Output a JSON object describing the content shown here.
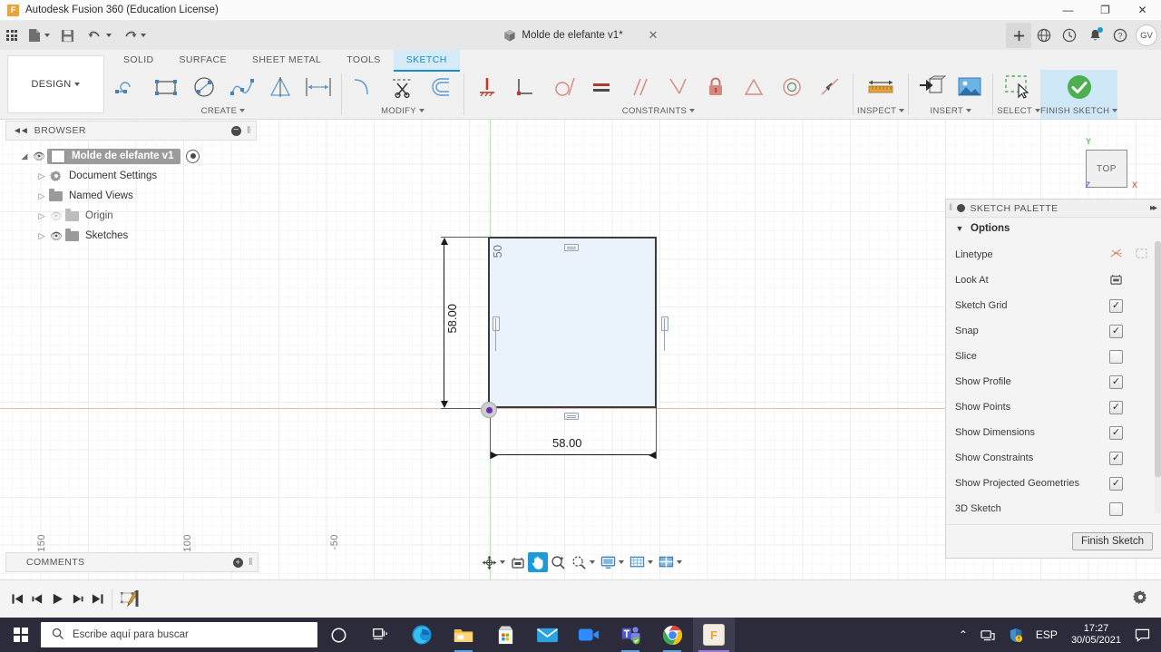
{
  "titlebar": {
    "app_title": "Autodesk Fusion 360 (Education License)",
    "logo_text": "F",
    "minimize": "—",
    "maximize": "❐",
    "close": "✕"
  },
  "quickaccess": {
    "grid_icon": "app-grid-icon",
    "new_icon": "new-document-icon",
    "save_icon": "save-icon",
    "undo_icon": "undo-icon",
    "redo_icon": "redo-icon",
    "document_tab": "Molde de elefante v1*",
    "document_close": "✕",
    "plus": "+",
    "data_panel_icon": "globe-icon",
    "history_icon": "clock-icon",
    "notification_icon": "bell-icon",
    "help_icon": "?",
    "avatar_initials": "GV"
  },
  "ribbon": {
    "workspace": "DESIGN",
    "tabs": [
      {
        "label": "SOLID",
        "active": false
      },
      {
        "label": "SURFACE",
        "active": false
      },
      {
        "label": "SHEET METAL",
        "active": false
      },
      {
        "label": "TOOLS",
        "active": false
      },
      {
        "label": "SKETCH",
        "active": true
      }
    ],
    "panels": [
      {
        "label": "CREATE",
        "dropdown": true
      },
      {
        "label": "MODIFY",
        "dropdown": true
      },
      {
        "label": "CONSTRAINTS",
        "dropdown": true
      },
      {
        "label": "INSPECT",
        "dropdown": true
      },
      {
        "label": "INSERT",
        "dropdown": true
      },
      {
        "label": "SELECT",
        "dropdown": true
      },
      {
        "label": "FINISH SKETCH",
        "dropdown": true
      }
    ],
    "create_tools": [
      "line-icon",
      "rectangle-icon",
      "circle-icon",
      "spline-icon",
      "mirror-icon",
      "sketch-dimension-icon"
    ],
    "modify_tools": [
      "fillet-icon",
      "trim-icon",
      "offset-icon"
    ],
    "constraint_tools": [
      "fix-constraint-icon",
      "perpendicular-icon",
      "tangent-icon",
      "equal-icon",
      "parallel-icon",
      "midpoint-icon",
      "lock-icon",
      "symmetry-icon",
      "concentric-icon",
      "collinear-icon"
    ],
    "inspect_tools": [
      "measure-icon"
    ],
    "insert_tools": [
      "insert-derive-icon",
      "insert-canvas-icon"
    ],
    "select_tools": [
      "select-window-icon"
    ],
    "finish_tools": [
      "finish-sketch-check-icon"
    ]
  },
  "browser": {
    "header": "BROWSER",
    "collapse_icon": "◄◄",
    "minus_icon": "−",
    "grip_icon": "‖",
    "items": [
      {
        "label": "Molde de elefante v1",
        "selected": true,
        "visible": true,
        "type": "component",
        "has_radio": true
      },
      {
        "label": "Document Settings",
        "selected": false,
        "visible": null,
        "type": "settings"
      },
      {
        "label": "Named Views",
        "selected": false,
        "visible": null,
        "type": "folder"
      },
      {
        "label": "Origin",
        "selected": false,
        "visible": false,
        "type": "folder"
      },
      {
        "label": "Sketches",
        "selected": false,
        "visible": true,
        "type": "folder"
      }
    ]
  },
  "comments": {
    "label": "COMMENTS",
    "plus_icon": "+",
    "grip_icon": "‖"
  },
  "canvas": {
    "view_orientation": "TOP",
    "axis_labels": {
      "x": "X",
      "y": "Y",
      "z": "Z"
    },
    "grid_ticks": [
      "-150",
      "-100",
      "-50"
    ],
    "sketch": {
      "width_dimension": "58.00",
      "height_dimension": "58.00",
      "corner_label": "50",
      "constraint_icons": [
        "horizontal-constraint-icon",
        "horizontal-constraint-icon",
        "vertical-constraint-icon",
        "vertical-constraint-icon"
      ],
      "origin_point": "origin-point"
    }
  },
  "palette": {
    "title": "SKETCH PALETTE",
    "expand_icon": "▸▸",
    "grip_icon": "‖",
    "section": "Options",
    "section_caret": "▼",
    "rows": [
      {
        "label": "Linetype",
        "control": "icons",
        "icons": [
          "construction-line-icon",
          "centerline-icon"
        ]
      },
      {
        "label": "Look At",
        "control": "icon",
        "icons": [
          "look-at-icon"
        ]
      },
      {
        "label": "Sketch Grid",
        "control": "checkbox",
        "checked": true
      },
      {
        "label": "Snap",
        "control": "checkbox",
        "checked": true
      },
      {
        "label": "Slice",
        "control": "checkbox",
        "checked": false
      },
      {
        "label": "Show Profile",
        "control": "checkbox",
        "checked": true
      },
      {
        "label": "Show Points",
        "control": "checkbox",
        "checked": true
      },
      {
        "label": "Show Dimensions",
        "control": "checkbox",
        "checked": true
      },
      {
        "label": "Show Constraints",
        "control": "checkbox",
        "checked": true
      },
      {
        "label": "Show Projected Geometries",
        "control": "checkbox",
        "checked": true
      },
      {
        "label": "3D Sketch",
        "control": "checkbox",
        "checked": false
      }
    ],
    "finish_button": "Finish Sketch"
  },
  "navbar": {
    "tools": [
      {
        "name": "orbit-icon",
        "active": false,
        "dropdown": true
      },
      {
        "name": "look-at-icon",
        "active": false,
        "dropdown": false
      },
      {
        "name": "pan-hand-icon",
        "active": true,
        "dropdown": false
      },
      {
        "name": "zoom-icon",
        "active": false,
        "dropdown": false
      },
      {
        "name": "zoom-window-icon",
        "active": false,
        "dropdown": true
      },
      {
        "name": "display-settings-icon",
        "active": false,
        "dropdown": true
      },
      {
        "name": "grid-snap-icon",
        "active": false,
        "dropdown": true
      },
      {
        "name": "viewports-icon",
        "active": false,
        "dropdown": true
      }
    ]
  },
  "timeline": {
    "buttons": [
      "skip-to-start-icon",
      "step-back-icon",
      "play-icon",
      "step-forward-icon",
      "skip-to-end-icon"
    ],
    "feature_icon": "sketch-feature-icon",
    "settings_icon": "gear-icon"
  },
  "taskbar": {
    "start_icon": "windows-start-icon",
    "search_placeholder": "Escribe aquí para buscar",
    "search_icon": "search-icon",
    "items": [
      {
        "name": "cortana-icon",
        "active": false,
        "open": false
      },
      {
        "name": "task-view-icon",
        "active": false,
        "open": false
      },
      {
        "name": "edge-icon",
        "active": false,
        "open": false
      },
      {
        "name": "file-explorer-icon",
        "active": false,
        "open": true
      },
      {
        "name": "microsoft-store-icon",
        "active": false,
        "open": false
      },
      {
        "name": "mail-icon",
        "active": false,
        "open": false
      },
      {
        "name": "video-call-icon",
        "active": false,
        "open": false
      },
      {
        "name": "teams-icon",
        "active": false,
        "open": true
      },
      {
        "name": "chrome-icon",
        "active": false,
        "open": true
      },
      {
        "name": "fusion360-icon",
        "active": true,
        "open": false
      }
    ],
    "tray": {
      "chevron": "⌃",
      "network_icon": "network-icon",
      "security_icon": "security-icon",
      "language": "ESP",
      "time": "17:27",
      "date": "30/05/2021",
      "action_center_icon": "action-center-icon"
    }
  },
  "colors": {
    "accent": "#1e9ad6",
    "tab_active_bg": "#d5ecf8",
    "finish_sketch_bg": "#cfe8f7",
    "sketch_fill": "#eaf3fb",
    "taskbar_bg": "#2b2b3c"
  }
}
